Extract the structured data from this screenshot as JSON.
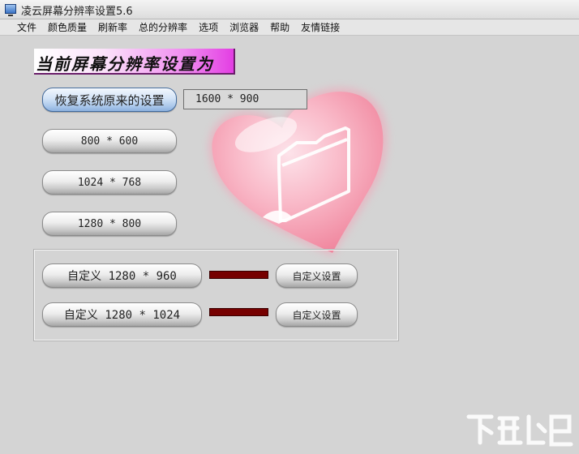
{
  "window": {
    "title": "凌云屏幕分辨率设置5.6"
  },
  "menu": [
    "文件",
    "颜色质量",
    "刷新率",
    "总的分辨率",
    "选项",
    "浏览器",
    "帮助",
    "友情链接"
  ],
  "banner": {
    "text": "当前屏幕分辨率设置为"
  },
  "restore_button": "恢复系统原来的设置",
  "current_resolution": "1600 * 900",
  "presets": [
    "800 * 600",
    "1024 * 768",
    "1280 * 800"
  ],
  "custom": [
    {
      "label": "自定义 1280 * 960",
      "settings_label": "自定义设置",
      "color": "#760000"
    },
    {
      "label": "自定义 1280 * 1024",
      "settings_label": "自定义设置",
      "color": "#760000"
    }
  ],
  "icons": {
    "app": "monitor-icon",
    "decoration": "heart-folder-icon",
    "watermark": "xiazaiba-watermark"
  },
  "colors": {
    "background": "#d4d4d4",
    "banner_gradient_end": "#e33ee3",
    "heart": "#f7a8b8"
  }
}
